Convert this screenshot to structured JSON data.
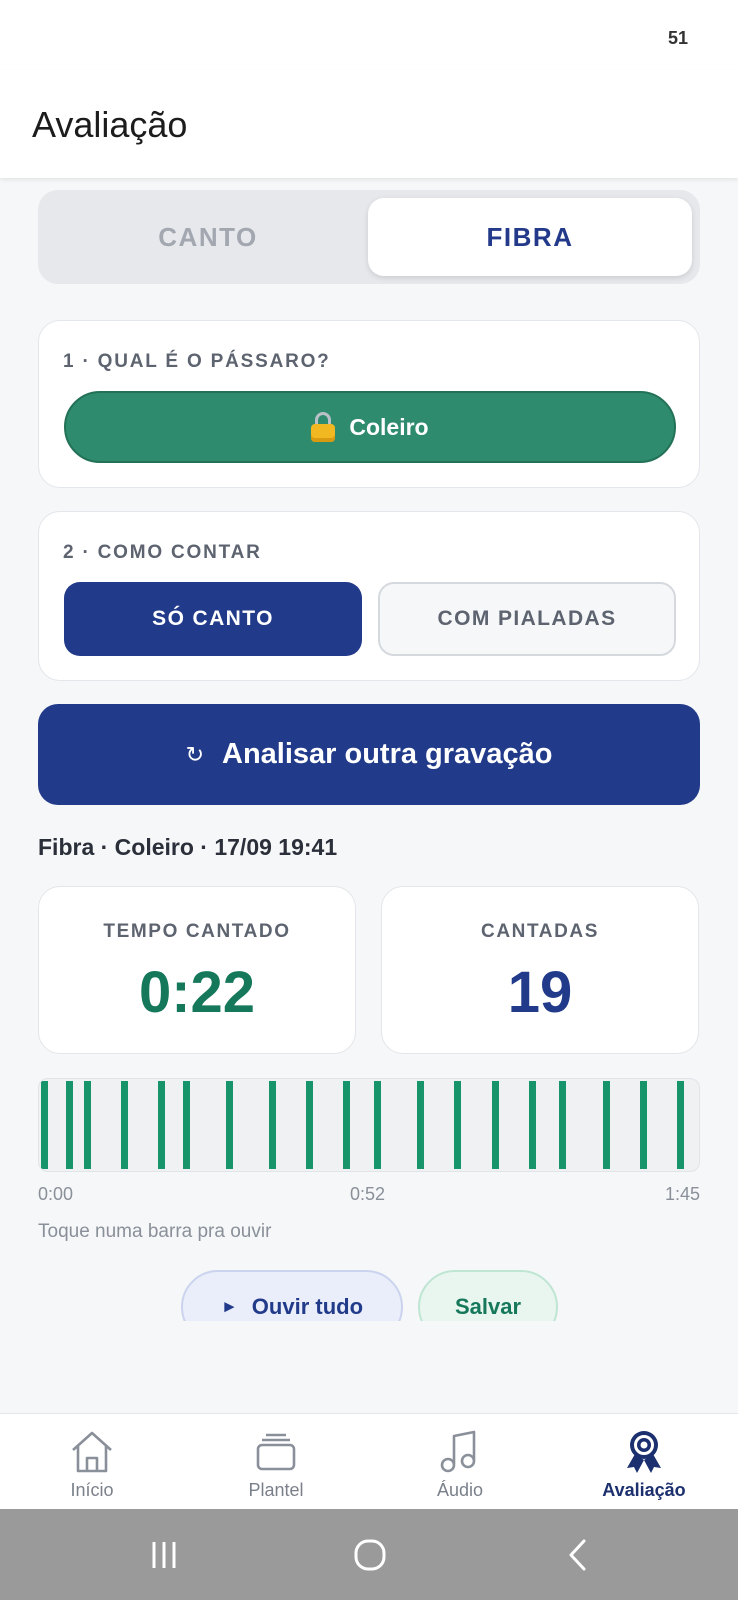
{
  "status_bar": {
    "indicator": "51"
  },
  "header": {
    "title": "Avaliação"
  },
  "segment": {
    "tabs": [
      {
        "label": "CANTO",
        "active": false
      },
      {
        "label": "FIBRA",
        "active": true
      }
    ]
  },
  "step1": {
    "label": "1 · QUAL É O PÁSSARO?",
    "bird_button": "Coleiro",
    "icon": "lock-icon"
  },
  "step2": {
    "label": "2 · COMO CONTAR",
    "options": [
      {
        "label": "SÓ CANTO",
        "selected": true
      },
      {
        "label": "COM PIALADAS",
        "selected": false
      }
    ]
  },
  "analyze": {
    "icon": "↻",
    "label": "Analisar outra gravação"
  },
  "result": {
    "title": "Fibra · Coleiro · 17/09 19:41",
    "time_label": "TEMPO CANTADO",
    "time_value": "0:22",
    "count_label": "CANTADAS",
    "count_value": "19"
  },
  "timeline": {
    "start": "0:00",
    "middle": "0:52",
    "end": "1:45",
    "hint": "Toque numa barra pra ouvir",
    "total_seconds": 105,
    "bar_times_seconds": [
      0,
      4,
      7,
      13,
      19,
      23,
      30,
      37,
      43,
      49,
      54,
      61,
      67,
      73,
      79,
      84,
      91,
      97,
      103
    ],
    "bar_color": "#17946a"
  },
  "actions": {
    "listen_icon": "►",
    "listen_label": "Ouvir tudo",
    "save_label": "Salvar"
  },
  "bottom_nav": {
    "items": [
      {
        "label": "Início",
        "icon": "home-icon",
        "active": false
      },
      {
        "label": "Plantel",
        "icon": "cards-icon",
        "active": false
      },
      {
        "label": "Áudio",
        "icon": "music-icon",
        "active": false
      },
      {
        "label": "Avaliação",
        "icon": "award-icon",
        "active": true
      }
    ]
  },
  "colors": {
    "primary": "#213a8a",
    "green": "#2e8b6d",
    "accent_green": "#16785a"
  }
}
